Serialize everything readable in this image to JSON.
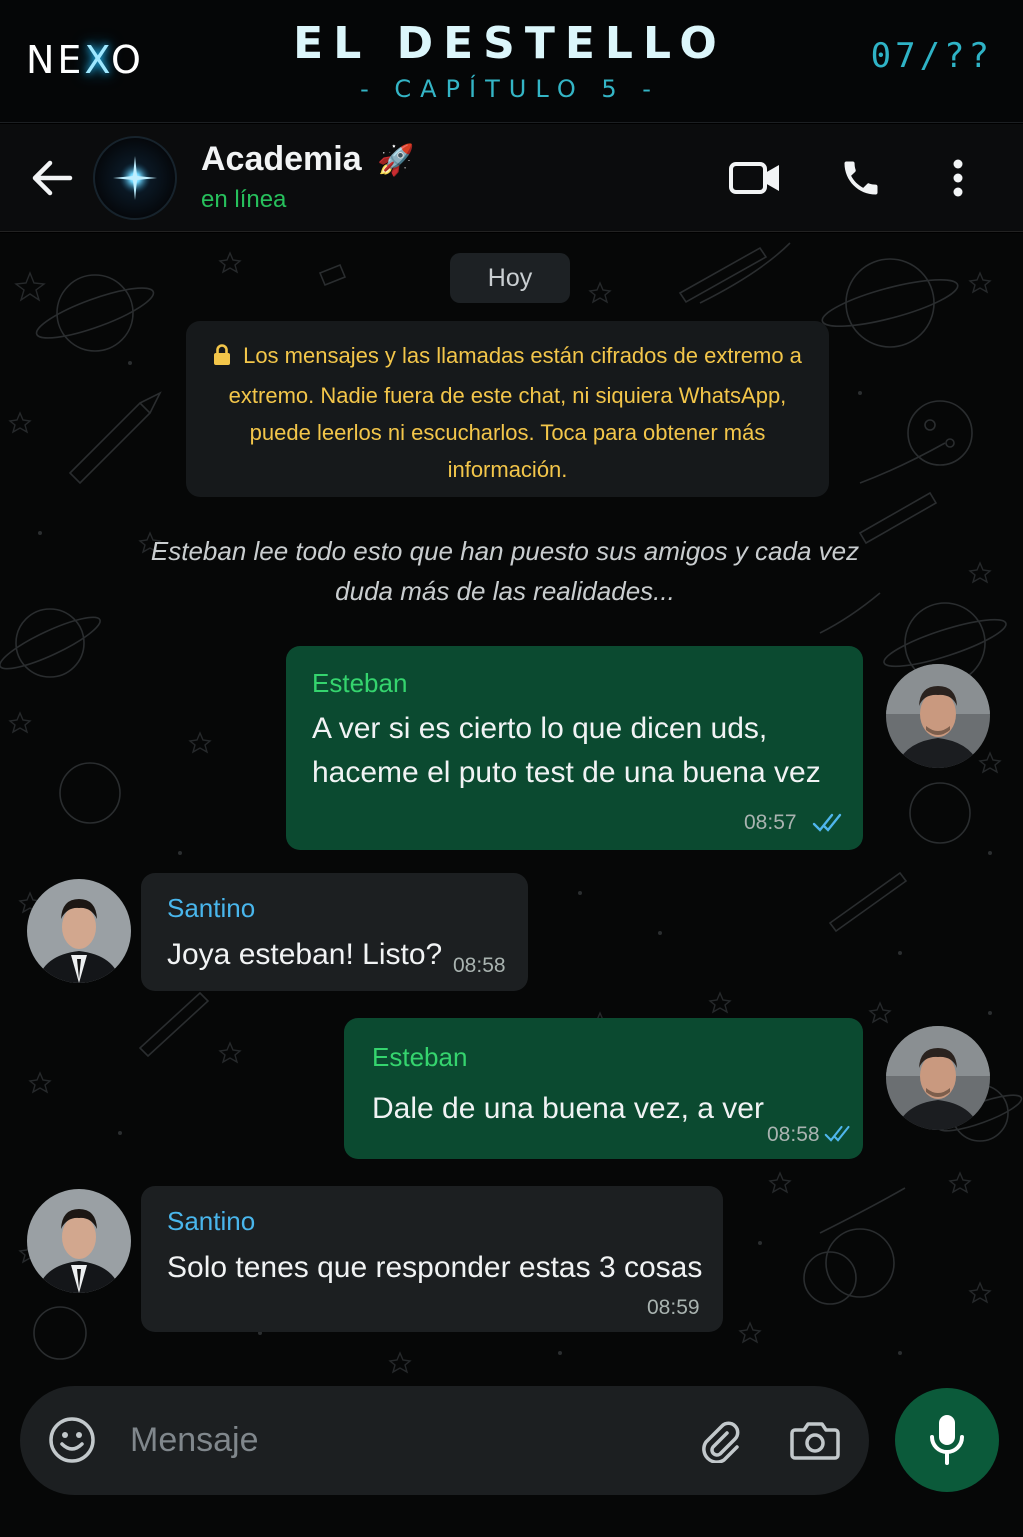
{
  "banner": {
    "logo": "NEXO",
    "title": "EL DESTELLO",
    "subtitle": "- CAPÍTULO 5 -",
    "page_count": "07/??"
  },
  "chat_header": {
    "group_name": "Academia",
    "group_emoji": "🚀",
    "status": "en línea",
    "icons": [
      "back-arrow-icon",
      "video-call-icon",
      "voice-call-icon",
      "more-options-icon"
    ]
  },
  "chat": {
    "day_label": "Hoy",
    "encryption_notice": "Los mensajes y las llamadas están cifrados de extremo a extremo. Nadie fuera de este chat, ni siquiera WhatsApp, puede leerlos ni escucharlos. Toca para obtener más información.",
    "narration": "Esteban lee todo esto que han puesto sus amigos y cada vez duda más de las realidades...",
    "messages": [
      {
        "direction": "outgoing",
        "sender": "Esteban",
        "lines": [
          "A ver si es cierto lo que dicen uds,",
          "haceme el puto test de una buena vez"
        ],
        "time": "08:57",
        "status": "read"
      },
      {
        "direction": "incoming",
        "sender": "Santino",
        "lines": [
          "Joya esteban! Listo?"
        ],
        "time": "08:58"
      },
      {
        "direction": "outgoing",
        "sender": "Esteban",
        "lines": [
          "Dale de una buena vez, a ver"
        ],
        "time": "08:58",
        "status": "read"
      },
      {
        "direction": "incoming",
        "sender": "Santino",
        "lines": [
          "Solo tenes que responder estas 3 cosas"
        ],
        "time": "08:59"
      }
    ]
  },
  "composer": {
    "placeholder": "Mensaje",
    "icons": [
      "emoji-icon",
      "attach-icon",
      "camera-icon",
      "microphone-icon"
    ]
  },
  "colors": {
    "outgoing_bubble": "#0b4a30",
    "incoming_bubble": "#1c1f21",
    "online_green": "#27c05c",
    "notice_yellow": "#f3c64a",
    "accent_cyan": "#2fb3c6",
    "read_ticks": "#4fb6ec"
  }
}
